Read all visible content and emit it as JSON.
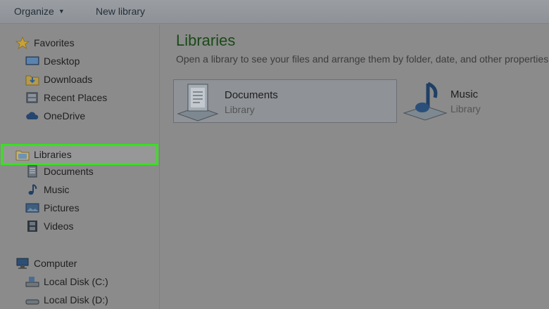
{
  "toolbar": {
    "organize_label": "Organize",
    "new_library_label": "New library"
  },
  "sidebar": {
    "favorites_label": "Favorites",
    "favorites": [
      "Desktop",
      "Downloads",
      "Recent Places",
      "OneDrive"
    ],
    "libraries_label": "Libraries",
    "libraries": [
      "Documents",
      "Music",
      "Pictures",
      "Videos"
    ],
    "computer_label": "Computer",
    "drives": [
      "Local Disk (C:)",
      "Local Disk (D:)"
    ]
  },
  "main": {
    "title": "Libraries",
    "subtitle": "Open a library to see your files and arrange them by folder, date, and other properties.",
    "libraries": [
      {
        "name": "Documents",
        "type": "Library"
      },
      {
        "name": "Music",
        "type": "Library"
      }
    ]
  },
  "colors": {
    "highlight": "#37e21e",
    "background": "#8b8b8b"
  }
}
